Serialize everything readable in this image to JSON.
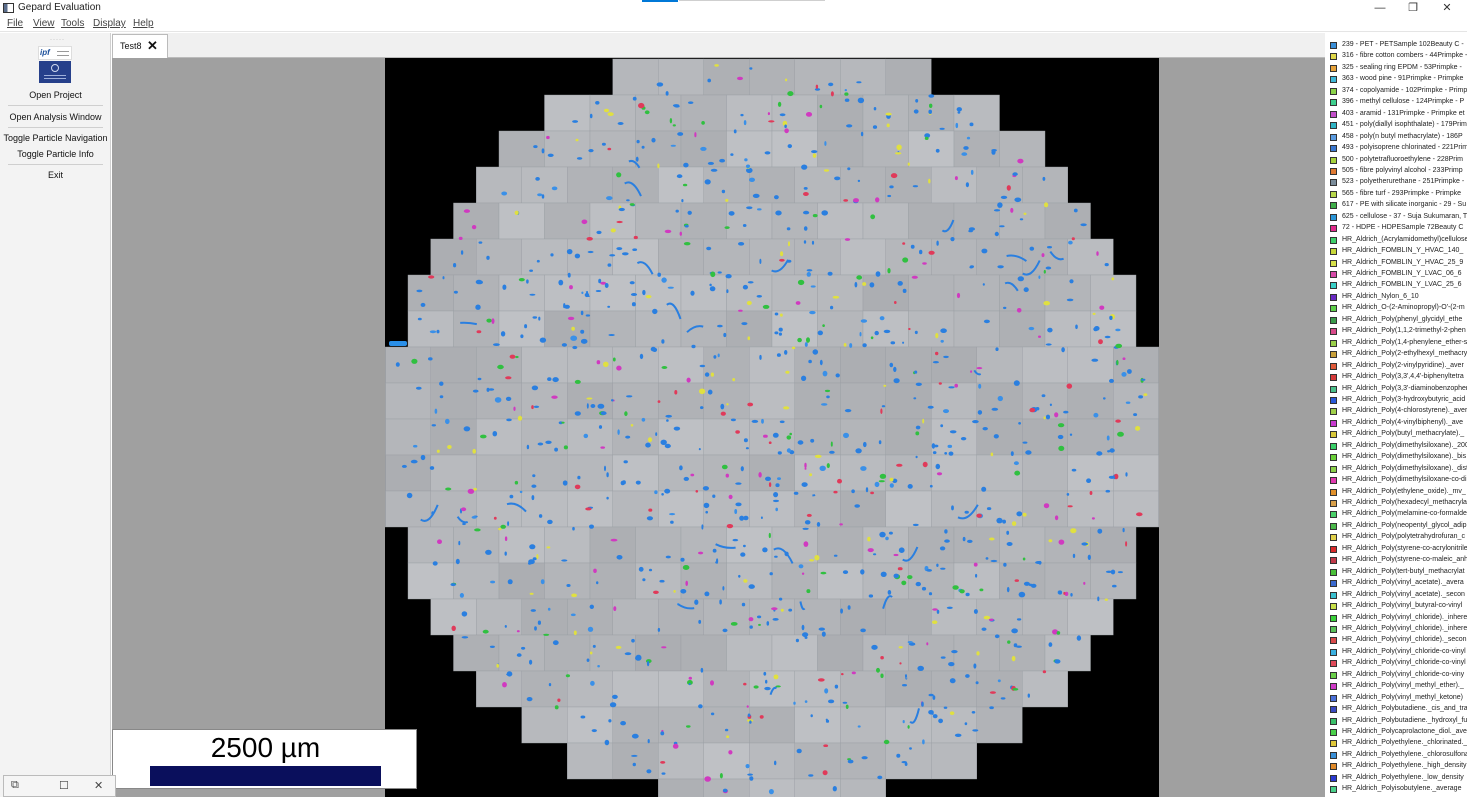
{
  "window": {
    "title": "Gepard Evaluation",
    "minimize": "—",
    "maximize": "❐",
    "close": "✕"
  },
  "menu": {
    "file": "File",
    "view": "View",
    "tools": "Tools",
    "display": "Display",
    "help": "Help"
  },
  "sidebar": {
    "logo_text": "ipf",
    "open_project": "Open Project",
    "open_analysis": "Open Analysis Window",
    "toggle_navigation": "Toggle Particle Navigation",
    "toggle_info": "Toggle Particle Info",
    "exit": "Exit"
  },
  "tab": {
    "label": "Test8",
    "close": "✕"
  },
  "scale": {
    "label": "2500 µm"
  },
  "float_window": {
    "restore": "⧉",
    "maximize": "☐",
    "close": "✕"
  },
  "legend": [
    {
      "color": "#3a8fd8",
      "label": "239 - PET - PETSample 102Beauty C -"
    },
    {
      "color": "#e0d84a",
      "label": "316 - fibre cotton combers - 44Primpke -"
    },
    {
      "color": "#e6a23a",
      "label": "325 - sealing ring EPDM - 53Primpke -"
    },
    {
      "color": "#3fb7d6",
      "label": "363 - wood pine - 91Primpke - Primpke"
    },
    {
      "color": "#8cd44a",
      "label": "374 - copolyamide - 102Primpke - Primp"
    },
    {
      "color": "#3ecf8e",
      "label": "396 - methyl cellulose - 124Primpke - P"
    },
    {
      "color": "#c24fc9",
      "label": "403 - aramid - 131Primpke - Primpke et"
    },
    {
      "color": "#2fb3c4",
      "label": "451 - poly(diallyl isophthalate) - 179Prim"
    },
    {
      "color": "#5a9be0",
      "label": "458 - poly(n butyl methacrylate) - 186P"
    },
    {
      "color": "#3a78d0",
      "label": "493 - polyisoprene chlorinated - 221Prim"
    },
    {
      "color": "#a6d23c",
      "label": "500 - polytetrafluoroethylene - 228Prim"
    },
    {
      "color": "#e07a32",
      "label": "505 - fibre polyvinyl alcohol - 233Primp"
    },
    {
      "color": "#7a8c9a",
      "label": "523 - polyetherurethane - 251Primpke -"
    },
    {
      "color": "#b6d64a",
      "label": "565 - fibre turf - 293Primpke - Primpke"
    },
    {
      "color": "#3fae4a",
      "label": "617 - PE with silicate inorganic - 29 - Su"
    },
    {
      "color": "#2a96d8",
      "label": "625 - cellulose - 37 - Suja Sukumaran, T"
    },
    {
      "color": "#e02a8c",
      "label": "72 - HDPE - HDPESample 72Beauty C"
    },
    {
      "color": "#3ecf6a",
      "label": "HR_Aldrich_(Acrylamidomethyl)cellulose"
    },
    {
      "color": "#c8d83a",
      "label": "HR_Aldrich_FOMBLIN_Y_HVAC_140_"
    },
    {
      "color": "#d6e04a",
      "label": "HR_Aldrich_FOMBLIN_Y_HVAC_25_9"
    },
    {
      "color": "#d64aa8",
      "label": "HR_Aldrich_FOMBLIN_Y_LVAC_06_6"
    },
    {
      "color": "#3ad0c8",
      "label": "HR_Aldrich_FOMBLIN_Y_LVAC_25_6"
    },
    {
      "color": "#6a2ac4",
      "label": "HR_Aldrich_Nylon_6_10"
    },
    {
      "color": "#5ed04a",
      "label": "HR_Aldrich_O-(2-Aminopropyl)-O'-(2-m"
    },
    {
      "color": "#3a9a4a",
      "label": "HR_Aldrich_Poly(phenyl_glycidyl_ethe"
    },
    {
      "color": "#d84a8a",
      "label": "HR_Aldrich_Poly(1,1,2-trimethyl-2-phen"
    },
    {
      "color": "#9ad04a",
      "label": "HR_Aldrich_Poly(1,4-phenylene_ether-s"
    },
    {
      "color": "#c8a03a",
      "label": "HR_Aldrich_Poly(2-ethylhexyl_methacry"
    },
    {
      "color": "#e05a3a",
      "label": "HR_Aldrich_Poly(2-vinylpyridine)._aver"
    },
    {
      "color": "#d63a3a",
      "label": "HR_Aldrich_Poly(3,3',4,4'-biphenyltetra"
    },
    {
      "color": "#4ac08a",
      "label": "HR_Aldrich_Poly(3,3'-diaminobenzopher"
    },
    {
      "color": "#2a5ad8",
      "label": "HR_Aldrich_Poly(3-hydroxybutyric_acid"
    },
    {
      "color": "#a0d04a",
      "label": "HR_Aldrich_Poly(4-chlorostyrene)._aver"
    },
    {
      "color": "#c83ad0",
      "label": "HR_Aldrich_Poly(4-vinylbiphenyl)._ave"
    },
    {
      "color": "#d8c83a",
      "label": "HR_Aldrich_Poly(butyl_methacrylate)._"
    },
    {
      "color": "#3ad06a",
      "label": "HR_Aldrich_Poly(dimethylsiloxane)._200"
    },
    {
      "color": "#6ad03a",
      "label": "HR_Aldrich_Poly(dimethylsiloxane)._bis"
    },
    {
      "color": "#8ad04a",
      "label": "HR_Aldrich_Poly(dimethylsiloxane)._dist"
    },
    {
      "color": "#e03ab0",
      "label": "HR_Aldrich_Poly(dimethylsiloxane-co-di"
    },
    {
      "color": "#e0902a",
      "label": "HR_Aldrich_Poly(ethylene_oxide)._mv_"
    },
    {
      "color": "#d8a04a",
      "label": "HR_Aldrich_Poly(hexadecyl_methacryla"
    },
    {
      "color": "#4ad06a",
      "label": "HR_Aldrich_Poly(melamine-co-formalde"
    },
    {
      "color": "#4ab84a",
      "label": "HR_Aldrich_Poly(neopentyl_glycol_adip"
    },
    {
      "color": "#e0d04a",
      "label": "HR_Aldrich_Poly(polytetrahydrofuran_c"
    },
    {
      "color": "#d82a2a",
      "label": "HR_Aldrich_Poly(styrene-co-acrylonitrile"
    },
    {
      "color": "#c03a4a",
      "label": "HR_Aldrich_Poly(styrene-co-maleic_anh"
    },
    {
      "color": "#4ac03a",
      "label": "HR_Aldrich_Poly(tert-butyl_methacrylat"
    },
    {
      "color": "#3a6ad0",
      "label": "HR_Aldrich_Poly(vinyl_acetate)._avera"
    },
    {
      "color": "#3ac0d0",
      "label": "HR_Aldrich_Poly(vinyl_acetate)._secon"
    },
    {
      "color": "#c8e04a",
      "label": "HR_Aldrich_Poly(vinyl_butyral-co-vinyl"
    },
    {
      "color": "#3ad03a",
      "label": "HR_Aldrich_Poly(vinyl_chloride)._inhere"
    },
    {
      "color": "#5ac05a",
      "label": "HR_Aldrich_Poly(vinyl_chloride)._inhere"
    },
    {
      "color": "#d84a4a",
      "label": "HR_Aldrich_Poly(vinyl_chloride)._secon"
    },
    {
      "color": "#3ab0e0",
      "label": "HR_Aldrich_Poly(vinyl_chloride-co-vinyl"
    },
    {
      "color": "#e04a5a",
      "label": "HR_Aldrich_Poly(vinyl_chloride-co-vinyl"
    },
    {
      "color": "#6ad04a",
      "label": "HR_Aldrich_Poly(vinyl_chloride-co-viny"
    },
    {
      "color": "#d03ac8",
      "label": "HR_Aldrich_Poly(vinyl_methyl_ether)._"
    },
    {
      "color": "#4a70d8",
      "label": "HR_Aldrich_Poly(vinyl_methyl_ketone)"
    },
    {
      "color": "#3a4ac0",
      "label": "HR_Aldrich_Polybutadiene._cis_and_tra"
    },
    {
      "color": "#3ac06a",
      "label": "HR_Aldrich_Polybutadiene._hydroxyl_fu"
    },
    {
      "color": "#4ad04a",
      "label": "HR_Aldrich_Polycaprolactone_diol._ave"
    },
    {
      "color": "#e0c83a",
      "label": "HR_Aldrich_Polyethylene._chlorinated._"
    },
    {
      "color": "#3a90d8",
      "label": "HR_Aldrich_Polyethylene._chlorosulfona"
    },
    {
      "color": "#e08a2a",
      "label": "HR_Aldrich_Polyethylene._high_density"
    },
    {
      "color": "#2a3ad0",
      "label": "HR_Aldrich_Polyethylene._low_density"
    },
    {
      "color": "#4ad08a",
      "label": "HR_Aldrich_Polyisobutylene._average"
    }
  ]
}
